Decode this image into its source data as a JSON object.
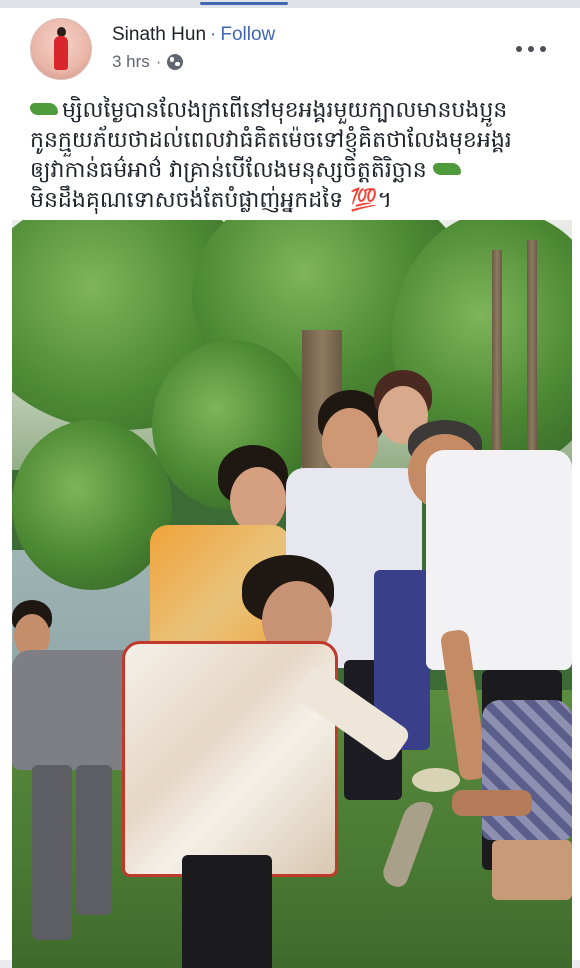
{
  "post": {
    "author": "Sinath Hun",
    "separator": "·",
    "follow_label": "Follow",
    "time": "3 hrs",
    "privacy_icon": "globe-icon",
    "more_icon": "more-options-icon",
    "caption_lines": [
      "ម្សិលម្ងៃបានលែងក្រពើនៅមុខអង្គរមួយក្បាលមានបងប្អូន",
      "កូនក្មួយភ័យថាដល់ពេលវាធំគិតម៉េចទៅខ្ញុំគិតថាលែងមុខអង្គរ",
      "ឲ្យវាកាន់ធម៌អាថ៌ វាគ្រាន់បើលែងមនុស្សចិត្តតិរិច្ឆាន",
      "មិនដឹងគុណទោសចង់តែបំផ្លាញ់អ្នកដទៃ 💯។"
    ],
    "caption_icon": "crocodile-emoji-icon",
    "photo_alt": "post-photo"
  },
  "colors": {
    "link": "#4267b2",
    "text": "#1d2129",
    "muted": "#606770"
  }
}
